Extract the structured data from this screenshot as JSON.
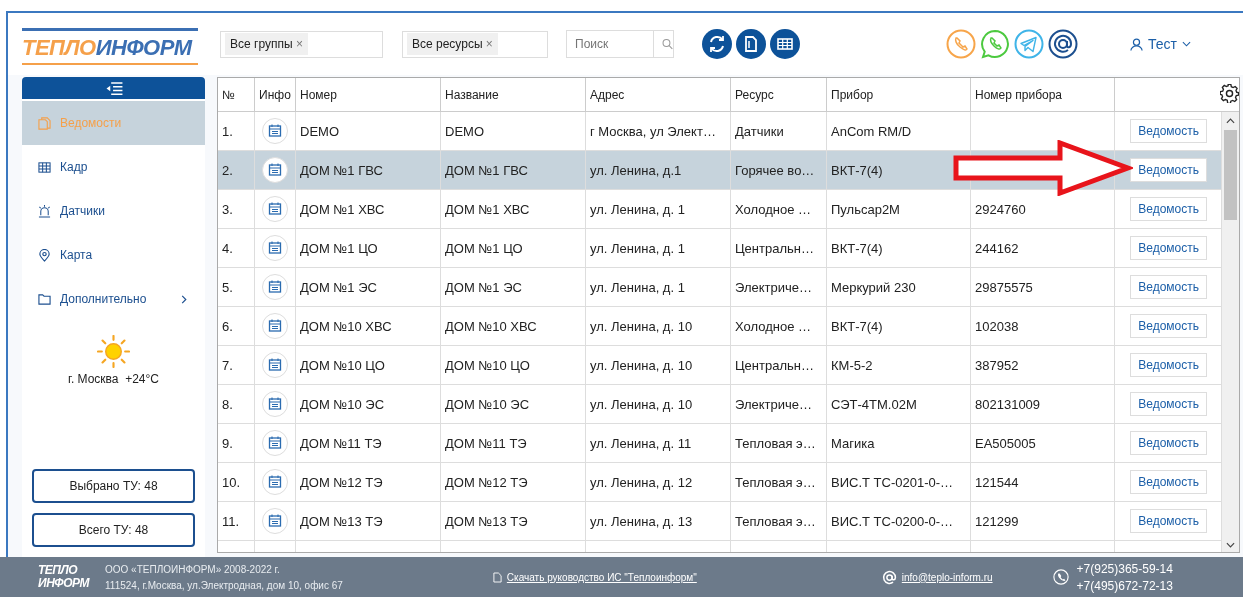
{
  "logo": {
    "part_1": "ТЕПЛО",
    "part_2": "ИНФОРМ"
  },
  "filters": [
    {
      "value": "Все группы",
      "remove": "×"
    },
    {
      "value": "Все ресурсы",
      "remove": "×"
    }
  ],
  "search": {
    "placeholder": "Поиск"
  },
  "user": {
    "name": "Тест"
  },
  "sidebar": {
    "items": [
      {
        "label": "Ведомости",
        "kind": "report",
        "selected": true
      },
      {
        "label": "Кадр",
        "kind": "grid",
        "selected": false
      },
      {
        "label": "Датчики",
        "kind": "alarm",
        "selected": false
      },
      {
        "label": "Карта",
        "kind": "pin",
        "selected": false
      },
      {
        "label": "Дополнительно",
        "kind": "folder",
        "selected": false,
        "submenu": true
      }
    ],
    "weather": "г. Москва  +24°C",
    "buttons": [
      "Выбрано ТУ: 48",
      "Всего ТУ: 48"
    ]
  },
  "table": {
    "columns": [
      "№",
      "Инфо",
      "Номер",
      "Название",
      "Адрес",
      "Ресурс",
      "Прибор",
      "Номер прибора"
    ],
    "rows": [
      {
        "n": "1.",
        "number": "DEMO",
        "name": "DEMO",
        "address": "г Москва, ул Элект…",
        "resource": "Датчики",
        "device": "AnCom RM/D",
        "serial": "",
        "action": "Ведомость",
        "selected": false
      },
      {
        "n": "2.",
        "number": "ДОМ №1 ГВС",
        "name": "ДОМ №1 ГВС",
        "address": "ул. Ленина, д.1",
        "resource": "Горячее во…",
        "device": "ВКТ-7(4)",
        "serial": "",
        "action": "Ведомость",
        "selected": true
      },
      {
        "n": "3.",
        "number": "ДОМ №1 ХВС",
        "name": "ДОМ №1 ХВС",
        "address": "ул. Ленина, д. 1",
        "resource": "Холодное …",
        "device": "Пульсар2М",
        "serial": "2924760",
        "action": "Ведомость",
        "selected": false
      },
      {
        "n": "4.",
        "number": "ДОМ №1 ЦО",
        "name": "ДОМ №1 ЦО",
        "address": "ул. Ленина, д. 1",
        "resource": "Центральн…",
        "device": "ВКТ-7(4)",
        "serial": "244162",
        "action": "Ведомость",
        "selected": false
      },
      {
        "n": "5.",
        "number": "ДОМ №1 ЭС",
        "name": "ДОМ №1 ЭС",
        "address": "ул. Ленина, д. 1",
        "resource": "Электриче…",
        "device": "Меркурий 230",
        "serial": "29875575",
        "action": "Ведомость",
        "selected": false
      },
      {
        "n": "6.",
        "number": "ДОМ №10 ХВС",
        "name": "ДОМ №10 ХВС",
        "address": "ул. Ленина, д. 10",
        "resource": "Холодное …",
        "device": "ВКТ-7(4)",
        "serial": "102038",
        "action": "Ведомость",
        "selected": false
      },
      {
        "n": "7.",
        "number": "ДОМ №10 ЦО",
        "name": "ДОМ №10 ЦО",
        "address": "ул. Ленина, д. 10",
        "resource": "Центральн…",
        "device": "КМ-5-2",
        "serial": "387952",
        "action": "Ведомость",
        "selected": false
      },
      {
        "n": "8.",
        "number": "ДОМ №10 ЭС",
        "name": "ДОМ №10 ЭС",
        "address": "ул. Ленина, д. 10",
        "resource": "Электриче…",
        "device": "СЭТ-4ТМ.02М",
        "serial": "802131009",
        "action": "Ведомость",
        "selected": false
      },
      {
        "n": "9.",
        "number": "ДОМ №11 ТЭ",
        "name": "ДОМ №11 ТЭ",
        "address": "ул. Ленина, д. 11",
        "resource": "Тепловая э…",
        "device": "Магика",
        "serial": "ЕА505005",
        "action": "Ведомость",
        "selected": false
      },
      {
        "n": "10.",
        "number": "ДОМ №12 ТЭ",
        "name": "ДОМ №12 ТЭ",
        "address": "ул. Ленина, д. 12",
        "resource": "Тепловая э…",
        "device": "ВИС.Т ТС-0201-0-…",
        "serial": "121544",
        "action": "Ведомость",
        "selected": false
      },
      {
        "n": "11.",
        "number": "ДОМ №13 ТЭ",
        "name": "ДОМ №13 ТЭ",
        "address": "ул. Ленина, д. 13",
        "resource": "Тепловая э…",
        "device": "ВИС.Т ТС-0200-0-…",
        "serial": "121299",
        "action": "Ведомость",
        "selected": false
      }
    ]
  },
  "footer": {
    "logo": {
      "part_1": "ТЕПЛО",
      "part_2": "ИНФОРМ"
    },
    "company": "ООО «ТЕПЛОИНФОРМ» 2008-2022 г.",
    "address": "111524, г.Москва, ул.Электродная, дом 10, офис 67",
    "manual_link": "Скачать руководство ИС \"Теплоинформ\"",
    "email": "info@teplo-inform.ru",
    "phones": [
      "+7(925)365-59-14",
      "+7(495)672-72-13"
    ]
  }
}
